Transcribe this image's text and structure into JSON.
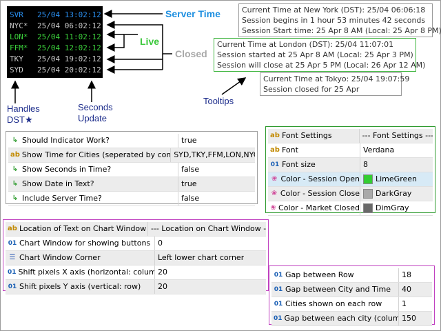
{
  "clock": {
    "rows": [
      {
        "city": "SVR",
        "time": "25/04 13:02:12",
        "color": "#2a8ff0"
      },
      {
        "city": "NYC*",
        "time": "25/04 06:02:12",
        "color": "#c8c8c8"
      },
      {
        "city": "LON*",
        "time": "25/04 11:02:12",
        "color": "#3cd23c"
      },
      {
        "city": "FFM*",
        "time": "25/04 12:02:12",
        "color": "#3cd23c"
      },
      {
        "city": "TKY",
        "time": "25/04 19:02:12",
        "color": "#c8c8c8"
      },
      {
        "city": "SYD",
        "time": "25/04 20:02:12",
        "color": "#c8c8c8"
      }
    ]
  },
  "labels": {
    "server_time": "Server Time",
    "live": "Live",
    "closed": "Closed",
    "tooltips": "Tooltips",
    "handles": "Handles",
    "dst": "DST★",
    "seconds": "Seconds",
    "update": "Update"
  },
  "tooltips": {
    "ny": [
      "Current Time at New York (DST): 25/04 06:06:18",
      "Session begins in 1 hour 53 minutes 42 seconds",
      "Session Start time: 25 Apr 8 AM (Local: 25 Apr 8 PM)"
    ],
    "london": [
      "Current Time at London (DST): 25/04 11:07:01",
      "Session started at 25 Apr 8 AM (Local: 25 Apr 3 PM)",
      "Session will close at 25 Apr 5 PM (Local: 26 Apr 12 AM)"
    ],
    "tokyo": [
      "Current Time at Tokyo: 25/04 19:07:59",
      "Session closed for 25 Apr"
    ]
  },
  "table_general": [
    {
      "icon": "arrow",
      "label": "Should Indicator Work?",
      "value": "true"
    },
    {
      "icon": "ab",
      "label": "Show Time for Cities (seperated by commas)",
      "value": "SYD,TKY,FFM,LON,NYC"
    },
    {
      "icon": "arrow",
      "label": "Show Seconds in Time?",
      "value": "false"
    },
    {
      "icon": "arrow",
      "label": "Show Date in Text?",
      "value": "true"
    },
    {
      "icon": "arrow",
      "label": "Include Server Time?",
      "value": "false"
    }
  ],
  "table_font": [
    {
      "icon": "ab",
      "label": "Font Settings",
      "value": "--- Font Settings ---"
    },
    {
      "icon": "ab",
      "label": "Font",
      "value": "Verdana"
    },
    {
      "icon": "01",
      "label": "Font size",
      "value": "8"
    },
    {
      "icon": "color",
      "label": "Color - Session Open",
      "value": "LimeGreen",
      "swatch": "#32cd32"
    },
    {
      "icon": "color",
      "label": "Color - Session Close",
      "value": "DarkGray",
      "swatch": "#a9a9a9"
    },
    {
      "icon": "color",
      "label": "Color - Market Closed",
      "value": "DimGray",
      "swatch": "#696969"
    }
  ],
  "table_location": [
    {
      "icon": "ab",
      "label": "Location of Text on Chart Window",
      "value": "--- Location on Chart Window ---"
    },
    {
      "icon": "01",
      "label": "Chart Window for showing buttons",
      "value": "0"
    },
    {
      "icon": "lines",
      "label": "Chart Window Corner",
      "value": "Left lower chart corner"
    },
    {
      "icon": "01",
      "label": "Shift pixels X axis (horizontal: column)",
      "value": "20"
    },
    {
      "icon": "01",
      "label": "Shift pixels Y axis (vertical: row)",
      "value": "20"
    }
  ],
  "table_gap": [
    {
      "icon": "01",
      "label": "Gap between Row",
      "value": "18"
    },
    {
      "icon": "01",
      "label": "Gap between City and Time",
      "value": "40"
    },
    {
      "icon": "01",
      "label": "Cities shown on each row",
      "value": "1"
    },
    {
      "icon": "01",
      "label": "Gap between each city (column)",
      "value": "150"
    }
  ],
  "colors": {
    "tooltip_ny_border": "#9a9a9a",
    "tooltip_london_border": "#3cb43c",
    "tooltip_tokyo_border": "#9a9a9a",
    "table_general_border": "#a0a0a0",
    "table_font_border": "#2e9a2e",
    "table_location_border": "#c040c0",
    "table_gap_border": "#c040c0"
  }
}
